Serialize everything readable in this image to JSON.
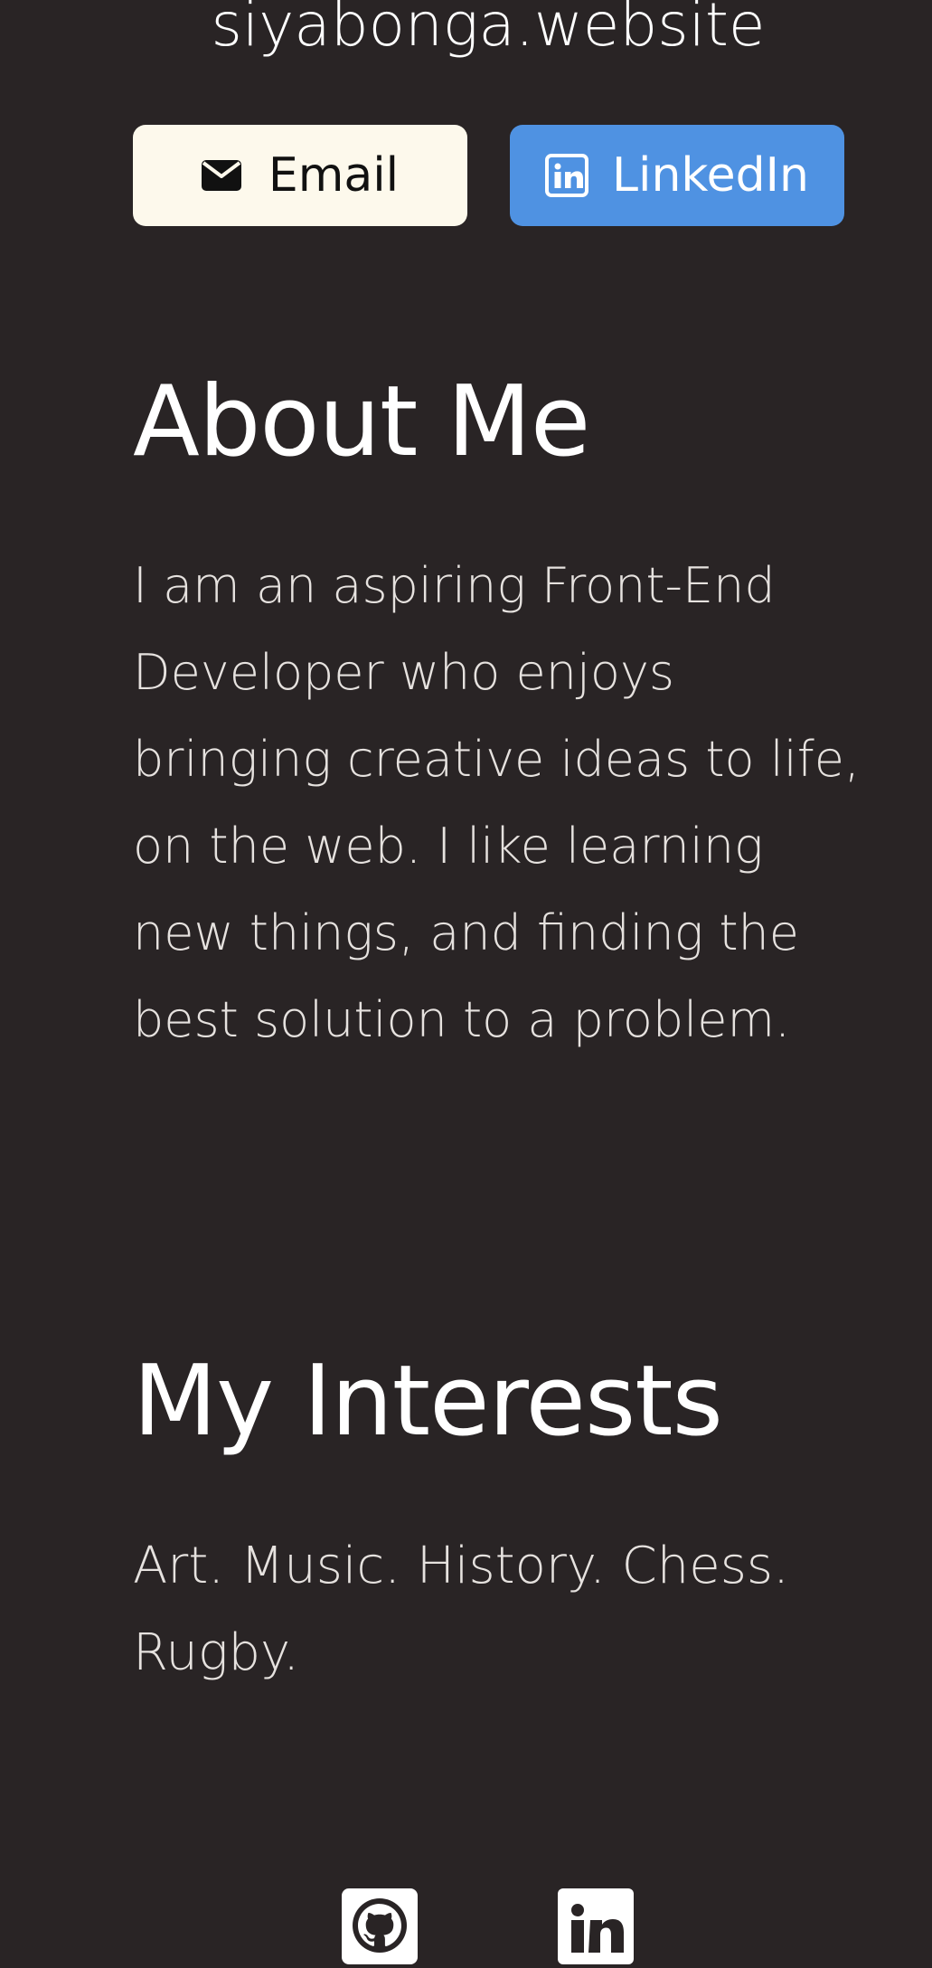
{
  "header": {
    "site_name": "siyabonga.website"
  },
  "contact_buttons": {
    "email": {
      "label": "Email",
      "icon": "envelope-icon",
      "background": "#fdf9ec",
      "text_color": "#111111"
    },
    "linkedin": {
      "label": "LinkedIn",
      "icon": "linkedin-icon",
      "background": "#4f92e2",
      "text_color": "#ffffff"
    }
  },
  "about": {
    "title": "About Me",
    "text": "I am an aspiring Front-End Developer who enjoys bringing creative ideas to life, on the web. I like learning new things, and finding the best solution to a problem."
  },
  "interests": {
    "title": "My Interests",
    "text": "Art. Music. History. Chess. Rugby."
  },
  "footer": {
    "icons": [
      "github-icon",
      "linkedin-icon"
    ]
  },
  "colors": {
    "background": "#292425",
    "text": "#ffffff",
    "body_text": "#e6e2df",
    "accent_blue": "#4f92e2",
    "cream": "#fdf9ec"
  }
}
